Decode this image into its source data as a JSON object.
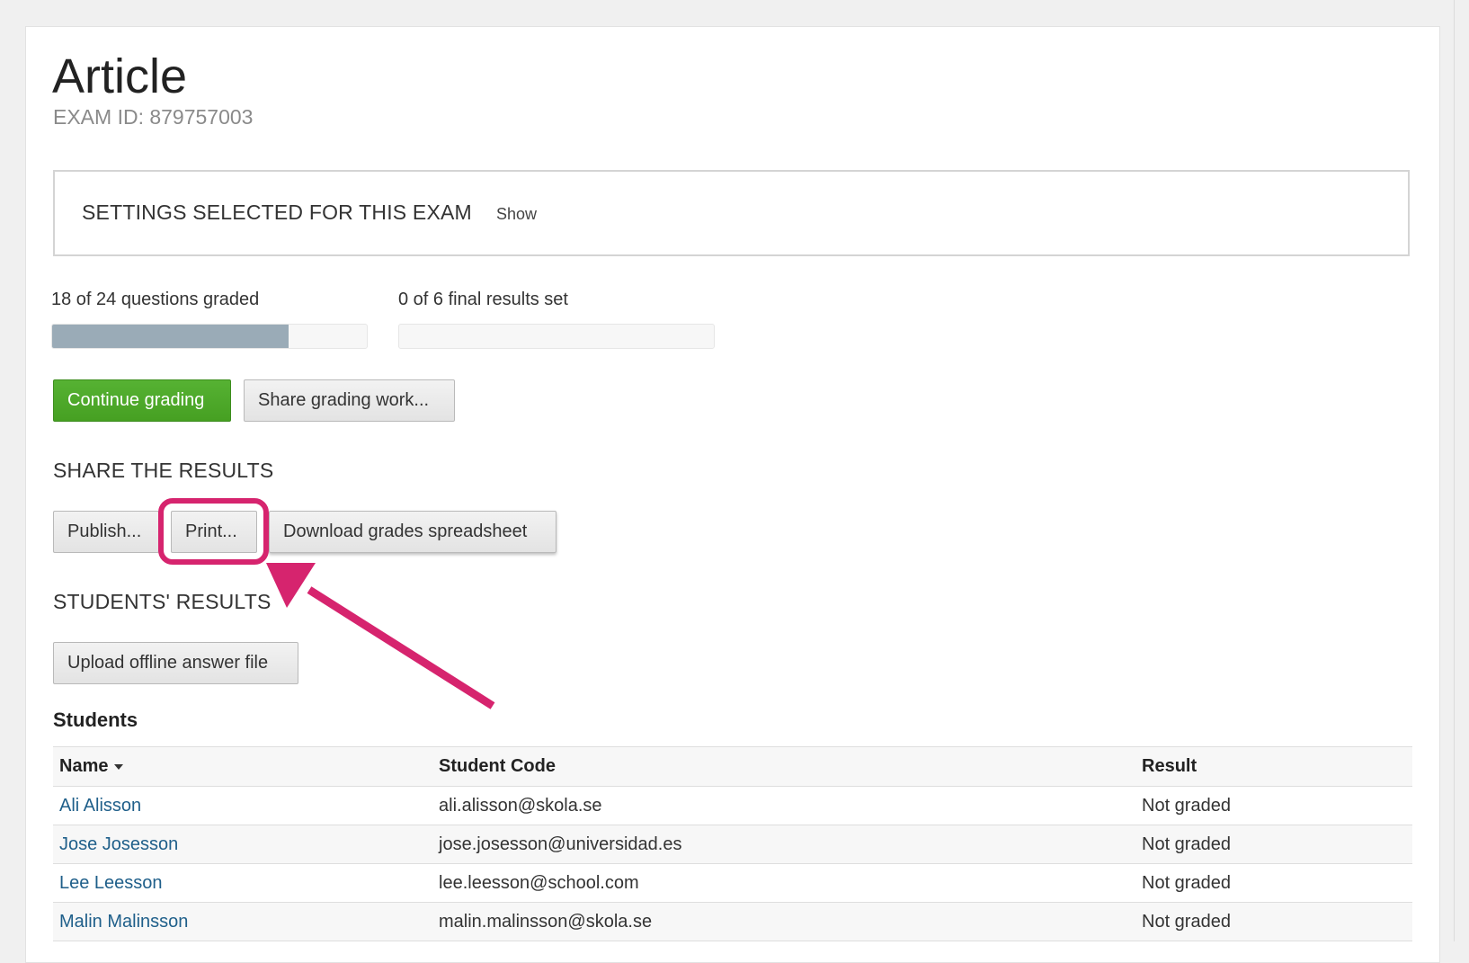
{
  "page": {
    "title": "Article",
    "exam_id": "EXAM ID: 879757003"
  },
  "settings": {
    "title": "SETTINGS SELECTED FOR THIS EXAM",
    "toggle_label": "Show"
  },
  "progress": {
    "graded_label": "18 of 24 questions graded",
    "graded_done": 18,
    "graded_total": 24,
    "results_label": "0 of 6 final results set",
    "results_done": 0,
    "results_total": 6,
    "fill_color": "#9aabb7"
  },
  "actions": {
    "continue_label": "Continue grading",
    "share_label": "Share grading work..."
  },
  "share_results": {
    "title": "SHARE THE RESULTS",
    "publish_label": "Publish...",
    "print_label": "Print...",
    "download_label": "Download grades spreadsheet"
  },
  "students_results": {
    "title": "STUDENTS' RESULTS",
    "upload_label": "Upload offline answer file"
  },
  "students": {
    "heading": "Students",
    "columns": {
      "name": "Name",
      "code": "Student Code",
      "result": "Result"
    },
    "rows": [
      {
        "name": "Ali Alisson",
        "code": "ali.alisson@skola.se",
        "result": "Not graded"
      },
      {
        "name": "Jose Josesson",
        "code": "jose.josesson@universidad.es",
        "result": "Not graded"
      },
      {
        "name": "Lee Leesson",
        "code": "lee.leesson@school.com",
        "result": "Not graded"
      },
      {
        "name": "Malin Malinsson",
        "code": "malin.malinsson@skola.se",
        "result": "Not graded"
      }
    ]
  },
  "colors": {
    "accent_green": "#4fa82a",
    "annotation_pink": "#d6246e",
    "link_blue": "#1f5f8a"
  }
}
